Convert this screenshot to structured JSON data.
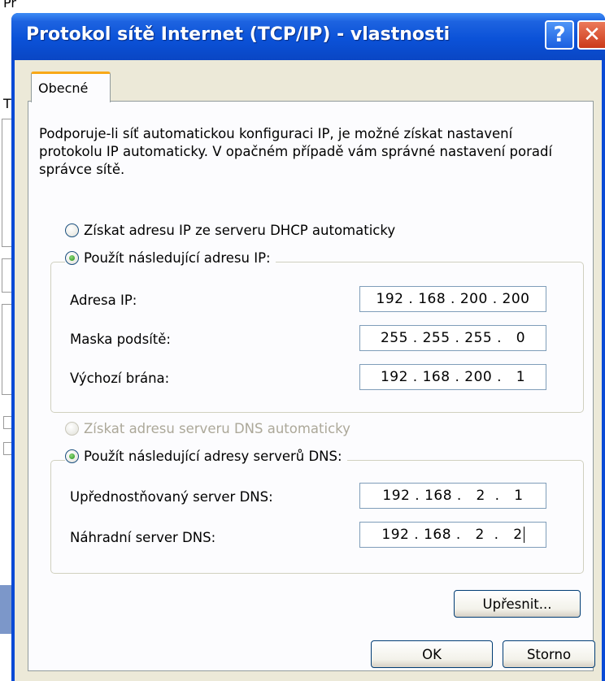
{
  "background": {
    "fragments": [
      "Př",
      "T"
    ]
  },
  "dialog": {
    "title": "Protokol sítě Internet (TCP/IP) - vlastnosti",
    "help_label": "?",
    "close_label": "✕",
    "tab_label": "Obecné",
    "description": "Podporuje-li síť automatickou konfiguraci IP, je možné získat nastavení protokolu IP automaticky. V opačném případě vám správné nastavení poradí správce sítě.",
    "ip": {
      "auto_label": "Získat adresu IP ze serveru DHCP automaticky",
      "auto_checked": false,
      "manual_label": "Použít následující adresu IP:",
      "manual_checked": true,
      "fields": [
        {
          "label": "Adresa IP:",
          "value": "192 . 168 . 200 . 200"
        },
        {
          "label": "Maska podsítě:",
          "value": "255 . 255 . 255 .   0"
        },
        {
          "label": "Výchozí brána:",
          "value": "192 . 168 . 200 .   1"
        }
      ]
    },
    "dns": {
      "auto_label": "Získat adresu serveru DNS automaticky",
      "auto_disabled": true,
      "manual_label": "Použít následující adresy serverů DNS:",
      "manual_checked": true,
      "fields": [
        {
          "label": "Upřednostňovaný server DNS:",
          "value": "192 . 168 .   2  .   1"
        },
        {
          "label": "Náhradní server DNS:",
          "value": "192 . 168 .   2  .   2"
        }
      ]
    },
    "advanced_button": "Upřesnit...",
    "ok_button": "OK",
    "cancel_button": "Storno"
  }
}
